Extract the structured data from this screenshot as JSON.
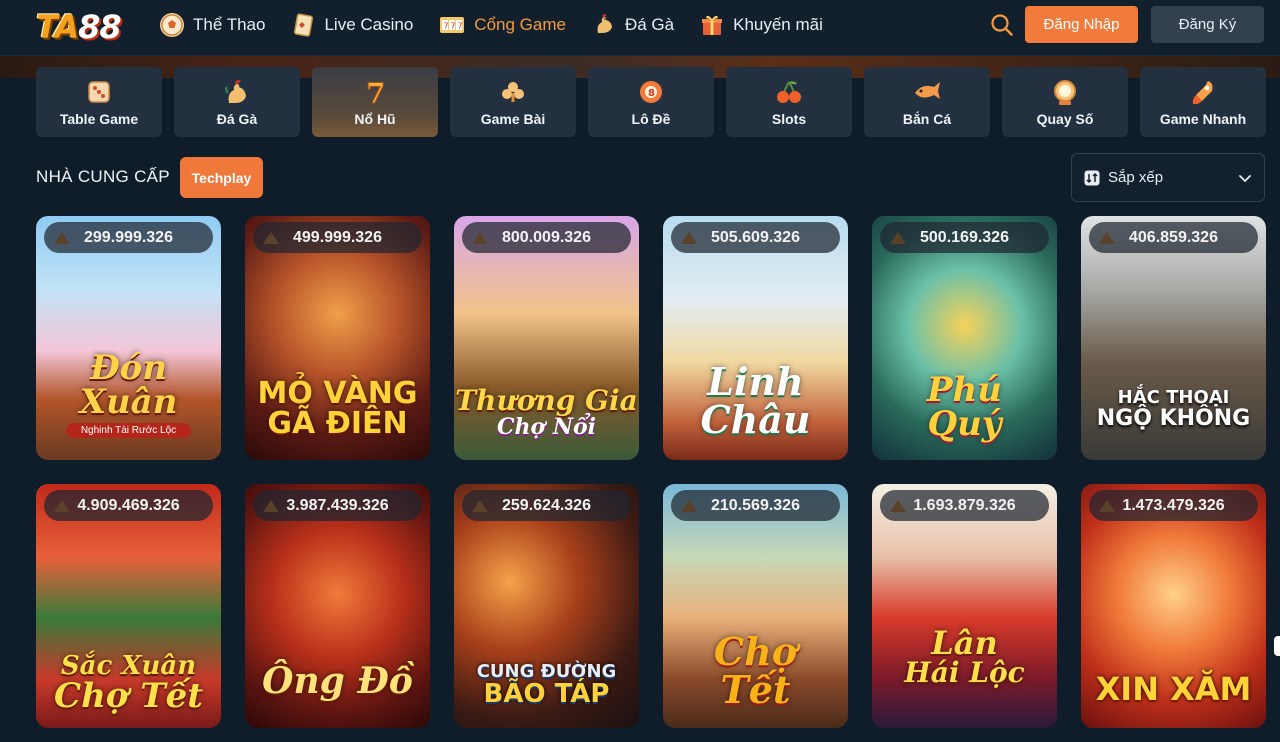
{
  "header": {
    "logo_text": "TA",
    "logo_num": "88",
    "nav": [
      {
        "label": "Thể Thao",
        "icon": "soccer-ball-icon"
      },
      {
        "label": "Live Casino",
        "icon": "playing-card-icon"
      },
      {
        "label": "Cổng Game",
        "icon": "slot-machine-icon",
        "active": true
      },
      {
        "label": "Đá Gà",
        "icon": "rooster-icon"
      },
      {
        "label": "Khuyến mãi",
        "icon": "gift-icon"
      }
    ],
    "login_label": "Đăng Nhập",
    "register_label": "Đăng Ký"
  },
  "categories": [
    {
      "label": "Table Game",
      "icon": "dice-icon"
    },
    {
      "label": "Đá Gà",
      "icon": "rooster-icon"
    },
    {
      "label": "Nổ Hũ",
      "icon": "seven-icon",
      "active": true
    },
    {
      "label": "Game Bài",
      "icon": "club-cards-icon"
    },
    {
      "label": "Lô Đề",
      "icon": "lottery-ball-icon"
    },
    {
      "label": "Slots",
      "icon": "cherry-icon"
    },
    {
      "label": "Bắn Cá",
      "icon": "fish-icon"
    },
    {
      "label": "Quay Số",
      "icon": "lottery-machine-icon"
    },
    {
      "label": "Game Nhanh",
      "icon": "rocket-icon"
    }
  ],
  "provider": {
    "title": "NHÀ CUNG CẤP",
    "chip": "Techplay"
  },
  "sort": {
    "label": "Sắp xếp"
  },
  "games": [
    {
      "jackpot": "299.999.326",
      "title1": "Đón",
      "title2": "Xuân",
      "subtitle": "Nghinh Tài Rước Lộc"
    },
    {
      "jackpot": "499.999.326",
      "title1": "MỎ VÀNG",
      "title2": "GÃ ĐIÊN",
      "subtitle": ""
    },
    {
      "jackpot": "800.009.326",
      "title1": "Thương Gia",
      "title2": "Chợ Nổi",
      "subtitle": ""
    },
    {
      "jackpot": "505.609.326",
      "title1": "Linh",
      "title2": "Châu",
      "subtitle": ""
    },
    {
      "jackpot": "500.169.326",
      "title1": "Phú",
      "title2": "Quý",
      "subtitle": ""
    },
    {
      "jackpot": "406.859.326",
      "title1": "HẮC THOẠI",
      "title2": "NGỘ KHÔNG",
      "subtitle": ""
    },
    {
      "jackpot": "4.909.469.326",
      "title1": "Sắc Xuân",
      "title2": "Chợ Tết",
      "subtitle": ""
    },
    {
      "jackpot": "3.987.439.326",
      "title1": "Ông Đồ",
      "title2": "",
      "subtitle": ""
    },
    {
      "jackpot": "259.624.326",
      "title1": "CUNG ĐƯỜNG",
      "title2": "BÃO TÁP",
      "subtitle": ""
    },
    {
      "jackpot": "210.569.326",
      "title1": "Chợ",
      "title2": "Tết",
      "subtitle": ""
    },
    {
      "jackpot": "1.693.879.326",
      "title1": "Lân",
      "title2": "Hái Lộc",
      "subtitle": ""
    },
    {
      "jackpot": "1.473.479.326",
      "title1": "XIN XĂM",
      "title2": "",
      "subtitle": ""
    }
  ],
  "colors": {
    "background": "#0f1d2b",
    "accent": "#f27a3a",
    "active_nav": "#f59a3d",
    "category_bg": "#22303f"
  }
}
